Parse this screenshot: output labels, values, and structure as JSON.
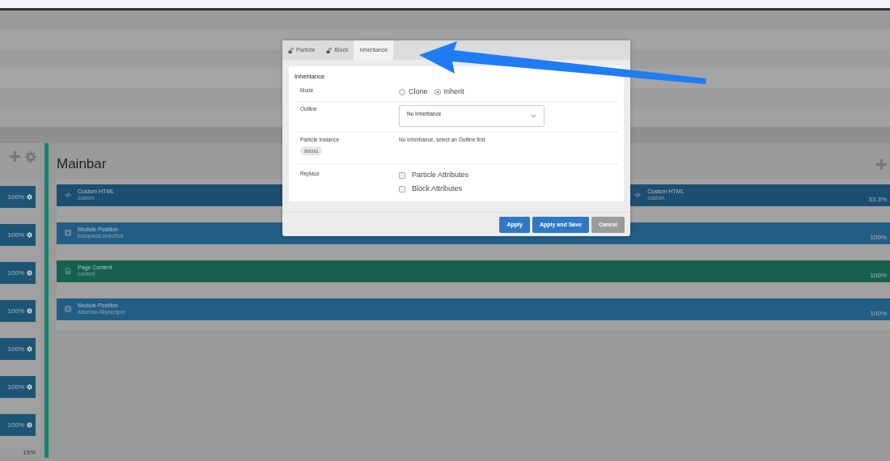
{
  "sidebar": {
    "blocks": [
      {
        "percent": "100%"
      },
      {
        "percent": "100%"
      },
      {
        "percent": "100%"
      },
      {
        "percent": "100%"
      },
      {
        "percent": "100%"
      },
      {
        "percent": "100%"
      },
      {
        "percent": "100%"
      }
    ],
    "footer_percent": "15%"
  },
  "mainbar": {
    "title": "Mainbar",
    "rows": [
      {
        "blocks": [
          {
            "kind": "code",
            "title": "Custom HTML",
            "subtitle": "custom",
            "color": "#1b4e70"
          },
          {
            "kind": "code",
            "title": "Custom HTML",
            "subtitle": "custom",
            "percent": "33.3%",
            "color": "#1b4e70"
          }
        ]
      },
      {
        "blocks": [
          {
            "kind": "module",
            "title": "Module Position",
            "subtitle": "busqueda-selectiva",
            "percent": "100%",
            "color": "#225d85"
          }
        ]
      },
      {
        "blocks": [
          {
            "kind": "page",
            "title": "Page Content",
            "subtitle": "content",
            "percent": "100%",
            "color": "#15614c"
          }
        ]
      },
      {
        "blocks": [
          {
            "kind": "module",
            "title": "Module Position",
            "subtitle": "adsense-Skyscraper",
            "percent": "100%",
            "color": "#225d85"
          }
        ]
      }
    ]
  },
  "dialog": {
    "tabs": [
      {
        "label": "Particle",
        "kind": "lock",
        "selected": false
      },
      {
        "label": "Block",
        "kind": "lock",
        "selected": false
      },
      {
        "label": "Inheritance",
        "kind": "plain",
        "selected": true
      }
    ],
    "section_title": "Inheritance",
    "mode": {
      "label": "Mode",
      "options": [
        {
          "label": "Clone",
          "selected": false
        },
        {
          "label": "Inherit",
          "selected": true
        }
      ]
    },
    "outline": {
      "label": "Outline",
      "value": "No Inheritance"
    },
    "particle_instance": {
      "label": "Particle Instance",
      "badge": "menu",
      "message": "No Inheritance, select an Outline first"
    },
    "replace": {
      "label": "Replace",
      "options": [
        {
          "label": "Particle Attributes",
          "checked": false
        },
        {
          "label": "Block Attributes",
          "checked": false
        }
      ]
    },
    "buttons": [
      {
        "label": "Apply",
        "kind": "primary"
      },
      {
        "label": "Apply and Save",
        "kind": "primary"
      },
      {
        "label": "Cancel",
        "kind": "secondary"
      }
    ]
  }
}
